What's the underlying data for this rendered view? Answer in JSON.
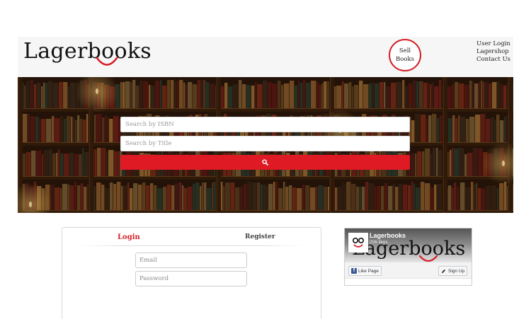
{
  "header": {
    "logo": "Lagerbooks",
    "sell_line1": "Sell",
    "sell_line2": "Books",
    "links": [
      "User Login",
      "Lagershop",
      "Contact Us"
    ]
  },
  "search": {
    "isbn_placeholder": "Search by ISBN",
    "title_placeholder": "Search by Title",
    "button_icon": "search-icon"
  },
  "auth": {
    "tab_login": "Login",
    "tab_register": "Register",
    "email_placeholder": "Email",
    "password_placeholder": "Password"
  },
  "facebook": {
    "page_name": "Lagerbooks",
    "likes": "206 likes",
    "cover_text": "Lagerbooks",
    "like_button": "Like Page",
    "signup_button": "Sign Up"
  },
  "colors": {
    "accent": "#d42027",
    "search_button": "#df1a24",
    "facebook": "#3b5998"
  }
}
